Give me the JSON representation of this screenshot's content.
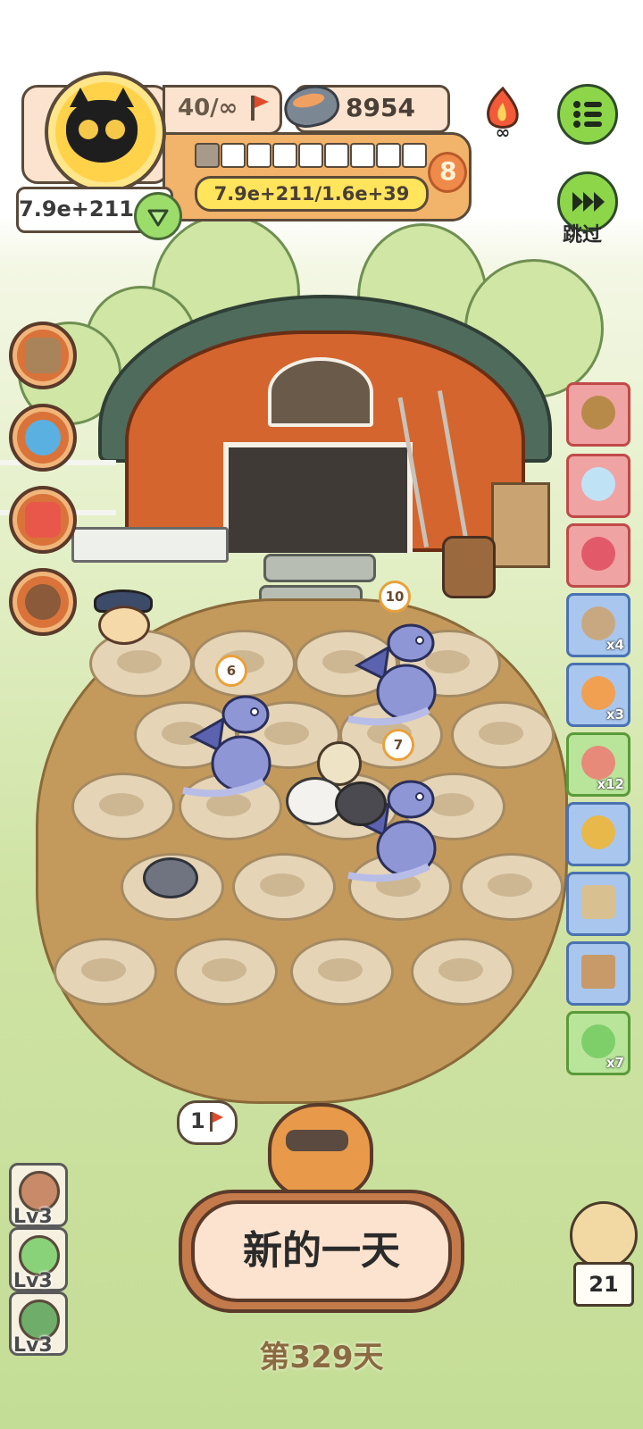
{
  "player": {
    "avatar_icon": "black-cat-icon",
    "flags": "40/∞",
    "flag_icon": "red-flag-icon",
    "bowls": "8954",
    "bowl_icon": "pet-bowl-icon",
    "power": "7.9e+211",
    "progress_text": "7.9e+211/1.6e+39",
    "level": "8",
    "progress_segments_filled": 1,
    "progress_segments_total": 9
  },
  "buttons": {
    "skip": "跳过",
    "new_day": "新的一天",
    "menu_icon": "menu-icon",
    "fire_icon": "fire-infinity-icon"
  },
  "day_label": "第329天",
  "speech_flag_count": "1",
  "field_badges": [
    "10",
    "6",
    "7"
  ],
  "side_menu": [
    "crate-icon",
    "gacha-machine-icon",
    "radio-icon",
    "magnifier-icon"
  ],
  "items": [
    {
      "icon": "scarf-icon",
      "count": "",
      "color": "red"
    },
    {
      "icon": "cloud-icon",
      "count": "",
      "color": "red"
    },
    {
      "icon": "heart-bag-icon",
      "count": "",
      "color": "red"
    },
    {
      "icon": "seed-sack-icon",
      "count": "x4",
      "color": "blue"
    },
    {
      "icon": "pumpkin-icon",
      "count": "x3",
      "color": "blue"
    },
    {
      "icon": "worm-icon",
      "count": "x12",
      "color": "green"
    },
    {
      "icon": "trophy-icon",
      "count": "",
      "color": "blue"
    },
    {
      "icon": "hut-icon",
      "count": "",
      "color": "blue"
    },
    {
      "icon": "cabinet-icon",
      "count": "",
      "color": "blue"
    },
    {
      "icon": "tent-icon",
      "count": "x7",
      "color": "green"
    }
  ],
  "levels": [
    "Lv3",
    "Lv3",
    "Lv3"
  ],
  "hamster_count": "21",
  "colors": {
    "accent_orange": "#f2b36a",
    "button_cream": "#fbe3cf",
    "green_button": "#8dd64a"
  }
}
